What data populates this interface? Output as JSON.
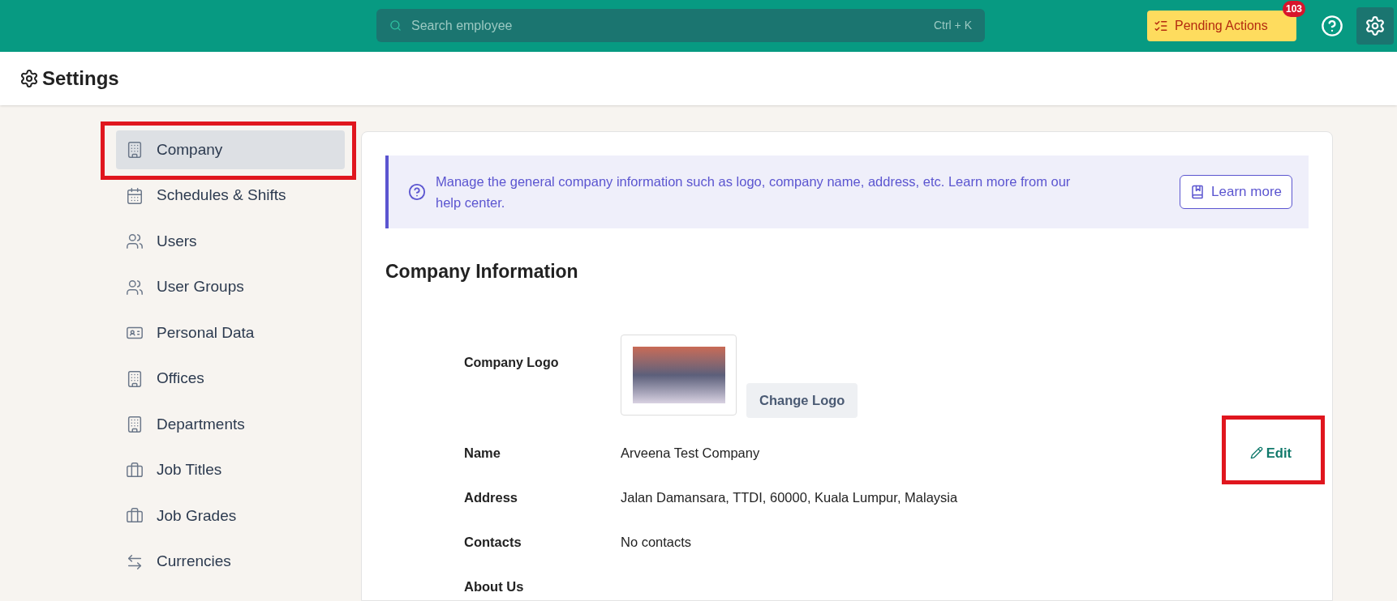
{
  "topbar": {
    "search": {
      "placeholder": "Search employee",
      "shortcut": "Ctrl + K"
    },
    "pending_actions": {
      "label": "Pending Actions",
      "badge": "103"
    }
  },
  "header": {
    "title": "Settings"
  },
  "sidebar": {
    "items": [
      {
        "label": "Company",
        "selected": true
      },
      {
        "label": "Schedules & Shifts",
        "selected": false
      },
      {
        "label": "Users",
        "selected": false
      },
      {
        "label": "User Groups",
        "selected": false
      },
      {
        "label": "Personal Data",
        "selected": false
      },
      {
        "label": "Offices",
        "selected": false
      },
      {
        "label": "Departments",
        "selected": false
      },
      {
        "label": "Job Titles",
        "selected": false
      },
      {
        "label": "Job Grades",
        "selected": false
      },
      {
        "label": "Currencies",
        "selected": false
      }
    ]
  },
  "banner": {
    "text": "Manage the general company information such as logo, company name, address, etc. Learn more from our help center.",
    "button": "Learn more"
  },
  "section": {
    "title": "Company Information",
    "logo_label": "Company Logo",
    "change_logo": "Change Logo",
    "edit": "Edit",
    "fields": [
      {
        "label": "Name",
        "value": "Arveena Test Company"
      },
      {
        "label": "Address",
        "value": "Jalan Damansara, TTDI, 60000, Kuala Lumpur, Malaysia"
      },
      {
        "label": "Contacts",
        "value": "No contacts"
      },
      {
        "label": "About Us"
      }
    ]
  }
}
